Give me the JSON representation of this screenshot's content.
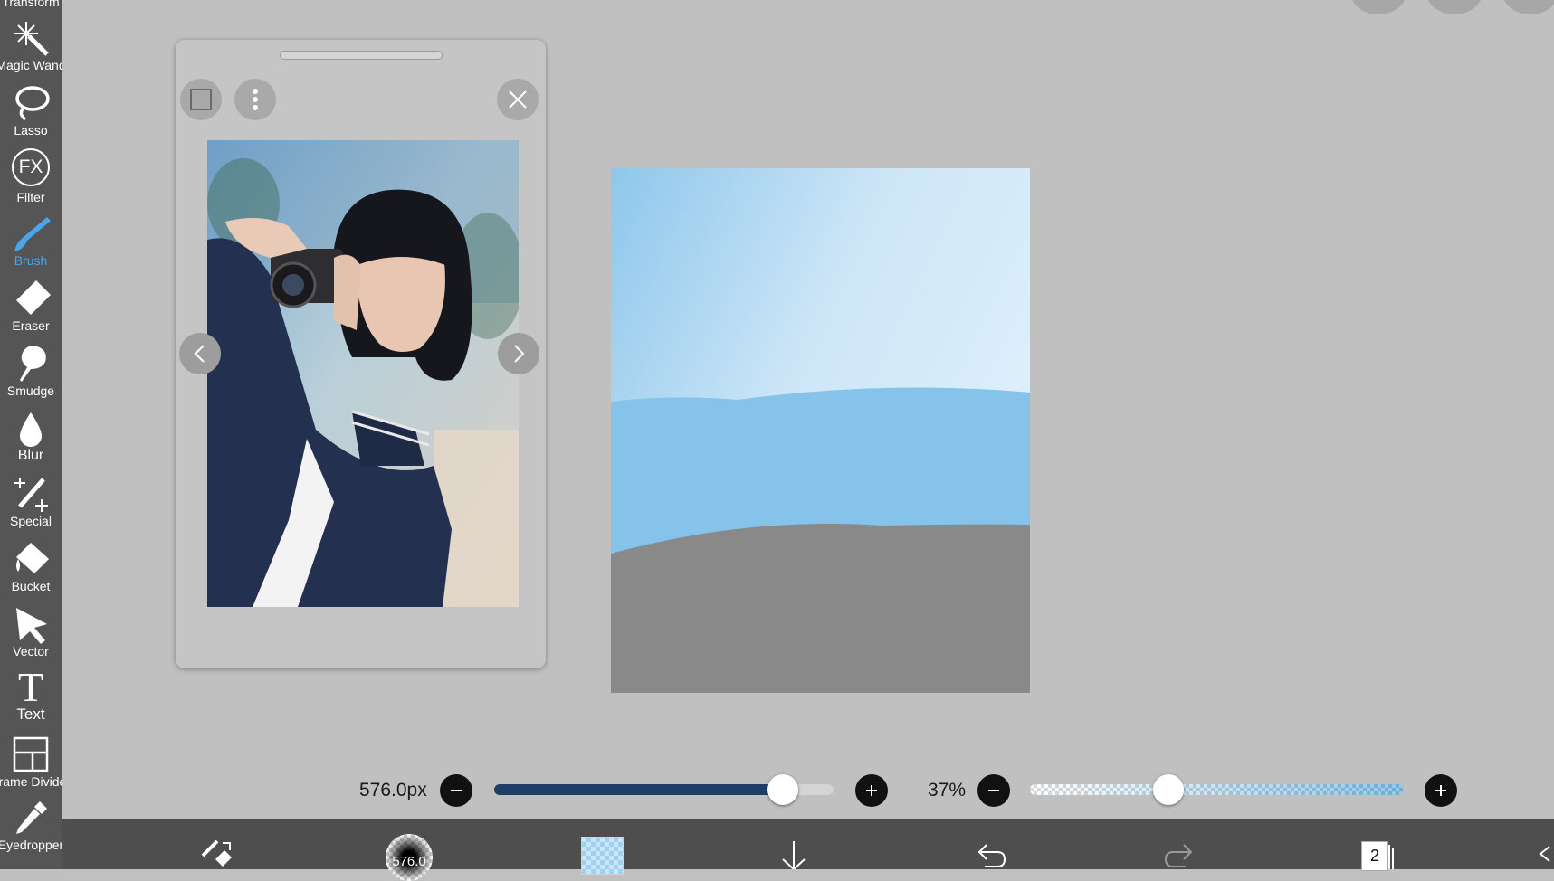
{
  "toolbar": {
    "items": [
      {
        "label": "Transform",
        "icon": "transform-icon"
      },
      {
        "label": "Magic Wand",
        "icon": "magic-wand-icon"
      },
      {
        "label": "Lasso",
        "icon": "lasso-icon"
      },
      {
        "label": "Filter",
        "icon": "fx-icon",
        "glyph": "FX"
      },
      {
        "label": "Brush",
        "icon": "brush-icon",
        "active": true
      },
      {
        "label": "Eraser",
        "icon": "eraser-icon"
      },
      {
        "label": "Smudge",
        "icon": "smudge-icon"
      },
      {
        "label": "Blur",
        "icon": "blur-drop-icon"
      },
      {
        "label": "Special",
        "icon": "special-wand-icon"
      },
      {
        "label": "Bucket",
        "icon": "bucket-icon"
      },
      {
        "label": "Vector",
        "icon": "vector-arrow-icon"
      },
      {
        "label": "Text",
        "icon": "text-icon",
        "glyph": "T"
      },
      {
        "label": "Frame Divider",
        "icon": "frame-divider-icon"
      },
      {
        "label": "Eyedropper",
        "icon": "eyedropper-icon"
      }
    ]
  },
  "reference_window": {
    "handle": "drag-handle",
    "buttons": [
      "frame-icon",
      "more-vertical-icon",
      "close-icon"
    ],
    "nav": [
      "chevron-left-icon",
      "chevron-right-icon"
    ]
  },
  "brush_size": {
    "value": "576.0px",
    "fraction": 0.85
  },
  "opacity": {
    "value": "37%",
    "fraction": 0.37
  },
  "bottom_bar": {
    "brush_size_badge": "576.0",
    "layer_count": "2"
  },
  "colors": {
    "toolbar_bg": "#555555",
    "accent_blue": "#4aa6ec",
    "size_track": "#1d3f66",
    "sky_band": "#85c3ea",
    "ground": "#898989",
    "bottom_bar": "#4e4e4e"
  }
}
